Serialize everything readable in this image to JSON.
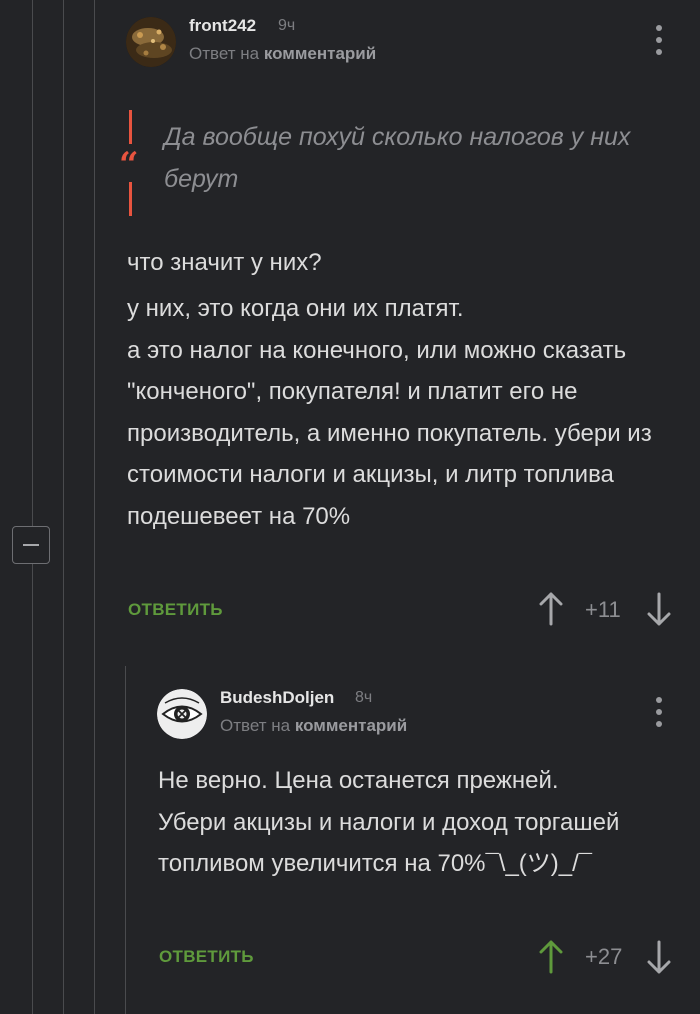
{
  "comment1": {
    "author": "front242",
    "time": "9ч",
    "reply_prefix": "Ответ на",
    "reply_target": "комментарий",
    "quote": "Да вообще похуй сколько налогов у них берут",
    "paragraphs": [
      "что значит у них?",
      "у них, это когда они их платят.\nа это налог на конечного, или можно сказать \"конченого\", покупателя! и платит его не производитель, а именно покупатель. убери из стоимости налоги и акцизы, и литр топлива подешевеет на 70%"
    ],
    "reply_label": "ОТВЕТИТЬ",
    "rating": "+11",
    "upvoted": false
  },
  "comment2": {
    "author": "BudeshDoljen",
    "time": "8ч",
    "reply_prefix": "Ответ на",
    "reply_target": "комментарий",
    "text": "Не верно. Цена останется прежней. Убери акцизы и налоги и доход торгашей топливом увеличится на 70%¯\\_(ツ)_/¯",
    "reply_label": "ОТВЕТИТЬ",
    "rating": "+27",
    "upvoted": true
  },
  "colors": {
    "background": "#232427",
    "accent_quote": "#e8543f",
    "reply_green": "#5f9a3c",
    "upvote_active": "#5f9a3c",
    "vote_inactive": "#a7a8ab"
  },
  "icons": {
    "collapse": "minus-icon",
    "more": "more-vertical-icon",
    "upvote": "arrow-up-icon",
    "downvote": "arrow-down-icon",
    "quote": "quote-mark-icon"
  }
}
